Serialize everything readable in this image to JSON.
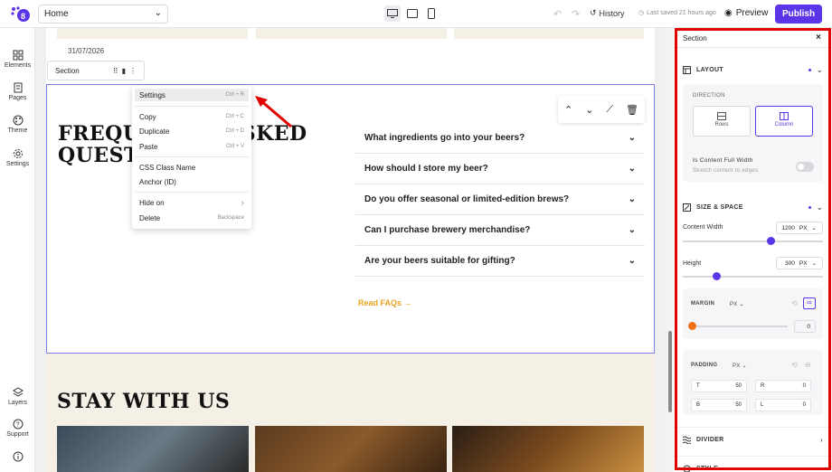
{
  "topbar": {
    "page_select": "Home",
    "history_label": "History",
    "last_saved": "Last saved 21 hours ago",
    "preview_label": "Preview",
    "publish_label": "Publish",
    "icons": [
      "logo-icon",
      "desktop-icon",
      "tablet-icon",
      "mobile-icon",
      "undo-icon",
      "redo-icon",
      "history-icon",
      "clock-icon",
      "eye-icon"
    ]
  },
  "leftbar": {
    "items": [
      {
        "label": "Elements",
        "icon": "grid-icon"
      },
      {
        "label": "Pages",
        "icon": "document-icon"
      },
      {
        "label": "Theme",
        "icon": "palette-icon"
      },
      {
        "label": "Settings",
        "icon": "gear-icon"
      }
    ],
    "bottom": [
      {
        "label": "Layers",
        "icon": "layers-icon"
      },
      {
        "label": "Support",
        "icon": "help-icon"
      },
      {
        "label": "",
        "icon": "info-icon"
      }
    ]
  },
  "canvas": {
    "date": "31/07/2026",
    "section_tag": "Section",
    "faq_title": "FREQUENTLY ASKED QUESTIONS",
    "faqs": [
      "What ingredients go into your beers?",
      "How should I store my beer?",
      "Do you offer seasonal or limited-edition brews?",
      "Can I purchase brewery merchandise?",
      "Are your beers suitable for gifting?"
    ],
    "read_faqs": "Read FAQs",
    "stay_title": "STAY WITH US"
  },
  "context_menu": {
    "items": [
      {
        "label": "Settings",
        "shortcut": "Ctrl + R"
      },
      {
        "label": "Copy",
        "shortcut": "Ctrl + C"
      },
      {
        "label": "Duplicate",
        "shortcut": "Ctrl + D"
      },
      {
        "label": "Paste",
        "shortcut": "Ctrl + V"
      },
      {
        "label": "CSS Class Name",
        "shortcut": ""
      },
      {
        "label": "Anchor (ID)",
        "shortcut": ""
      },
      {
        "label": "Hide on",
        "shortcut": "›"
      },
      {
        "label": "Delete",
        "shortcut": "Backspace"
      }
    ]
  },
  "panel": {
    "title": "Section",
    "layout_label": "LAYOUT",
    "direction_label": "DIRECTION",
    "rows_label": "Rows",
    "column_label": "Column",
    "full_width_label": "Is Content Full Width",
    "full_width_hint": "Stretch content to edges",
    "size_label": "SIZE & SPACE",
    "content_width_label": "Content Width",
    "content_width_value": "1200",
    "content_width_unit": "PX",
    "content_width_fraction": 0.63,
    "height_label": "Height",
    "height_value": "300",
    "height_unit": "PX",
    "height_fraction": 0.24,
    "margin_label": "MARGIN",
    "margin_unit": "PX",
    "margin_value": "0",
    "padding_label": "PADDING",
    "padding_unit": "PX",
    "padding": {
      "t_label": "T",
      "t": "50",
      "r_label": "R",
      "r": "0",
      "b_label": "B",
      "b": "50",
      "l_label": "L",
      "l": "0"
    },
    "divider_label": "DIVIDER",
    "style_label": "STYLE"
  },
  "colors": {
    "accent": "#5b36e8",
    "highlight_frame": "#e00000",
    "link": "#e8a320",
    "cream": "#f4f0e6",
    "selection": "#7b7fe8"
  }
}
